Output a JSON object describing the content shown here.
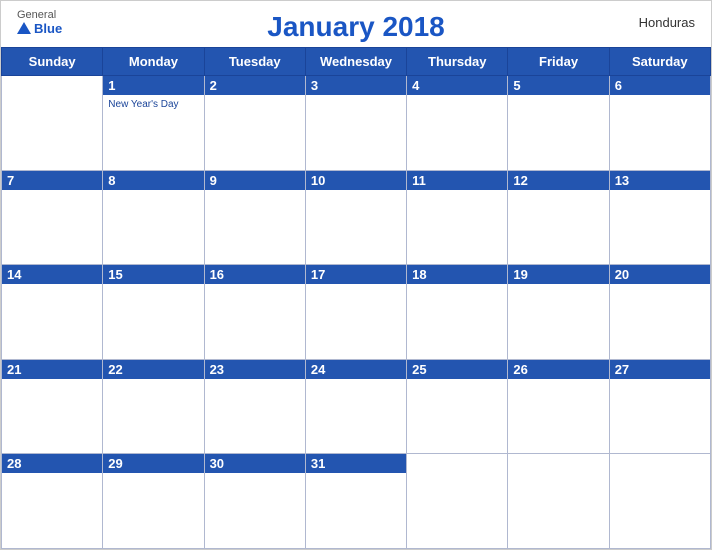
{
  "brand": {
    "general": "General",
    "blue": "Blue",
    "logo": "triangle"
  },
  "title": "January 2018",
  "country": "Honduras",
  "days_of_week": [
    "Sunday",
    "Monday",
    "Tuesday",
    "Wednesday",
    "Thursday",
    "Friday",
    "Saturday"
  ],
  "weeks": [
    [
      {
        "day": null
      },
      {
        "day": 1,
        "holiday": "New Year's Day"
      },
      {
        "day": 2
      },
      {
        "day": 3
      },
      {
        "day": 4
      },
      {
        "day": 5
      },
      {
        "day": 6
      }
    ],
    [
      {
        "day": 7
      },
      {
        "day": 8
      },
      {
        "day": 9
      },
      {
        "day": 10
      },
      {
        "day": 11
      },
      {
        "day": 12
      },
      {
        "day": 13
      }
    ],
    [
      {
        "day": 14
      },
      {
        "day": 15
      },
      {
        "day": 16
      },
      {
        "day": 17
      },
      {
        "day": 18
      },
      {
        "day": 19
      },
      {
        "day": 20
      }
    ],
    [
      {
        "day": 21
      },
      {
        "day": 22
      },
      {
        "day": 23
      },
      {
        "day": 24
      },
      {
        "day": 25
      },
      {
        "day": 26
      },
      {
        "day": 27
      }
    ],
    [
      {
        "day": 28
      },
      {
        "day": 29
      },
      {
        "day": 30
      },
      {
        "day": 31
      },
      {
        "day": null
      },
      {
        "day": null
      },
      {
        "day": null
      }
    ]
  ],
  "colors": {
    "header_bg": "#2355b0",
    "header_text": "#ffffff",
    "title_color": "#1a56c4",
    "border": "#b0b8d0"
  }
}
